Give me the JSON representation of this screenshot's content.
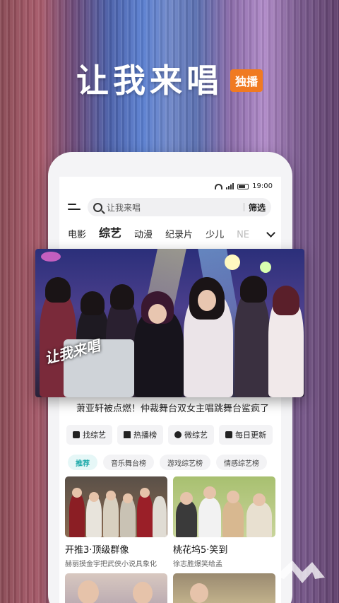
{
  "headline": {
    "title": "让我来唱",
    "badge": "独播"
  },
  "status_bar": {
    "time": "19:00"
  },
  "search": {
    "placeholder": "让我来唱",
    "filter_label": "筛选"
  },
  "tabs": [
    {
      "label": "电影"
    },
    {
      "label": "综艺",
      "active": true
    },
    {
      "label": "动漫"
    },
    {
      "label": "纪录片"
    },
    {
      "label": "少儿"
    },
    {
      "label": "NE"
    }
  ],
  "hero": {
    "logo_text": "让我来唱",
    "caption": "萧亚轩被点燃！仲裁舞台双女主唱跳舞台鲨疯了"
  },
  "shortcuts": [
    {
      "label": "找综艺",
      "icon": "grid-icon"
    },
    {
      "label": "热播榜",
      "icon": "podium-icon"
    },
    {
      "label": "微综艺",
      "icon": "infinity-icon"
    },
    {
      "label": "每日更新",
      "icon": "tv-icon"
    }
  ],
  "filters": [
    {
      "label": "推荐",
      "active": true
    },
    {
      "label": "音乐舞台榜"
    },
    {
      "label": "游戏综艺榜"
    },
    {
      "label": "情感综艺榜"
    }
  ],
  "cards": [
    {
      "title": "开推3·顶级群像",
      "subtitle": "赫丽摸金宇把武侠小说具象化"
    },
    {
      "title": "桃花坞5·笑到",
      "subtitle": "徐志胜爆笑给孟"
    }
  ],
  "colors": {
    "accent_orange": "#f07a22",
    "accent_teal": "#1ba9a9"
  }
}
